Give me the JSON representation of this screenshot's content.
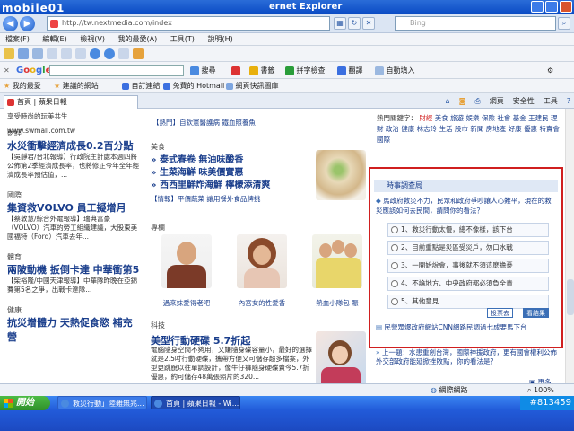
{
  "window": {
    "title": "ernet Explorer",
    "logo_text": "mobile01"
  },
  "address_bar": {
    "url": "http://tw.nextmedia.com/index",
    "search_placeholder": "Bing"
  },
  "menu": [
    "檔案(F)",
    "編輯(E)",
    "檢視(V)",
    "我的最愛(A)",
    "工具(T)",
    "說明(H)"
  ],
  "google_bar": {
    "brand": "Google",
    "items": [
      "搜尋",
      "書籤",
      "拼字檢查",
      "翻譯",
      "自動填入"
    ]
  },
  "favorites_bar": {
    "label": "我的最愛",
    "items": [
      "建議的網站",
      "自訂連結",
      "免費的 Hotmail",
      "網頁快訊圖庫"
    ]
  },
  "tab": {
    "label": "首頁 | 蘋果日報",
    "right_items": [
      "網頁",
      "安全性",
      "工具"
    ]
  },
  "left_column": {
    "top_text": "享受時尚的玩美共生",
    "top_url": "www.swmall.com.tw",
    "sections": [
      {
        "title": "財經",
        "headline": "水災衝擊經濟成長0.2百分點",
        "summary": "【吳靜君/台北報導】行政院主計處本週四將公佈第2季經濟成長率，也將修正今年全年經濟成長率預估值，..."
      },
      {
        "title": "國際",
        "headline": "集資救VOLVO 員工擬增月",
        "summary": "【蔡敦慧/綜合外電報導】瑞典富豪（VOLVO）汽車的勞工組織建議，大股東美國福特（Ford）汽車去年..."
      },
      {
        "title": "體育",
        "headline": "兩陂動機 扳倒卡達 中華衝第5",
        "summary": "【柴裕隆/中國天津報導】中華隊昨晚在亞錦賽第5名之爭，出戰卡達隊..."
      },
      {
        "title": "健康",
        "headline": "抗災增體力 天熱促食慾 補充營"
      }
    ]
  },
  "middle_column": {
    "top_items": [
      "【熱門】自欽憲醫護病 鐵血照養魚"
    ],
    "food": {
      "title": "美食",
      "items": [
        "泰式春卷 無油味酸香",
        "生菜海鮮 味美價實惠",
        "西西里鮮炸海鮮 檸檬添清爽"
      ],
      "tag": "【情報】平價蔬菜 讓用餐外食品牌挑"
    },
    "photos": {
      "title": "專欄",
      "captions": [
        "過來妹愛得老吧",
        "內宮女的性愛香",
        "熱血小隊包 賑"
      ]
    },
    "tech": {
      "title": "科技",
      "headline": "美型行動硬碟 5.7折起",
      "summary": "電腦隨身空間不夠用，又嫌隨身碟容量小，最好的選擇就是2.5吋行動硬碟，攜帶方便又可儲存超多檔案，外型更跳脫以往單調設計，像牛仔褲隨身硬碟賣今5.7折優惠，約可儲存48萬張照片的320..."
    }
  },
  "right_column": {
    "hot_keywords_title": "熱門關鍵字：",
    "hot_keywords": [
      "財經",
      "美食",
      "旅遊",
      "娛樂",
      "保險",
      "社會",
      "基金",
      "王建民",
      "理財",
      "政治",
      "健康",
      "林志玲",
      "生活",
      "股市",
      "新聞",
      "房地產",
      "好康",
      "優惠",
      "特賣會",
      "國際"
    ]
  },
  "poll": {
    "title": "時事調查局",
    "question": "馬政府救災不力，民眾和政府爭吵讓人心難平，現在的救災應該如何去民間，請問你的看法？",
    "options": [
      "1、救災行動太慢，總不像樣，該下台",
      "2、目前重點是災區受災戶，勿口水戰",
      "3、一開始說會，事後就不須這麼擔憂",
      "4、不論地方、中央政府都必須負全責",
      "5、其他意見"
    ],
    "buttons": [
      "投票去",
      "看結果"
    ],
    "footer_link": "民營眾爆政府網站CNN網路民調過七成要馬下台",
    "previous": "上一題：水患重創台灣，國際神援政府，更有國會權利公佈外交部政府能延掀挫敗點，你的看法是？",
    "more": "更多"
  },
  "status": {
    "zone": "網際網路",
    "zoom": "100%"
  },
  "taskbar": {
    "start": "開始",
    "tasks": [
      "救災行動」陸難無兆...",
      "首頁 | 蘋果日報 - Wi..."
    ],
    "tray_text": "#813459"
  }
}
